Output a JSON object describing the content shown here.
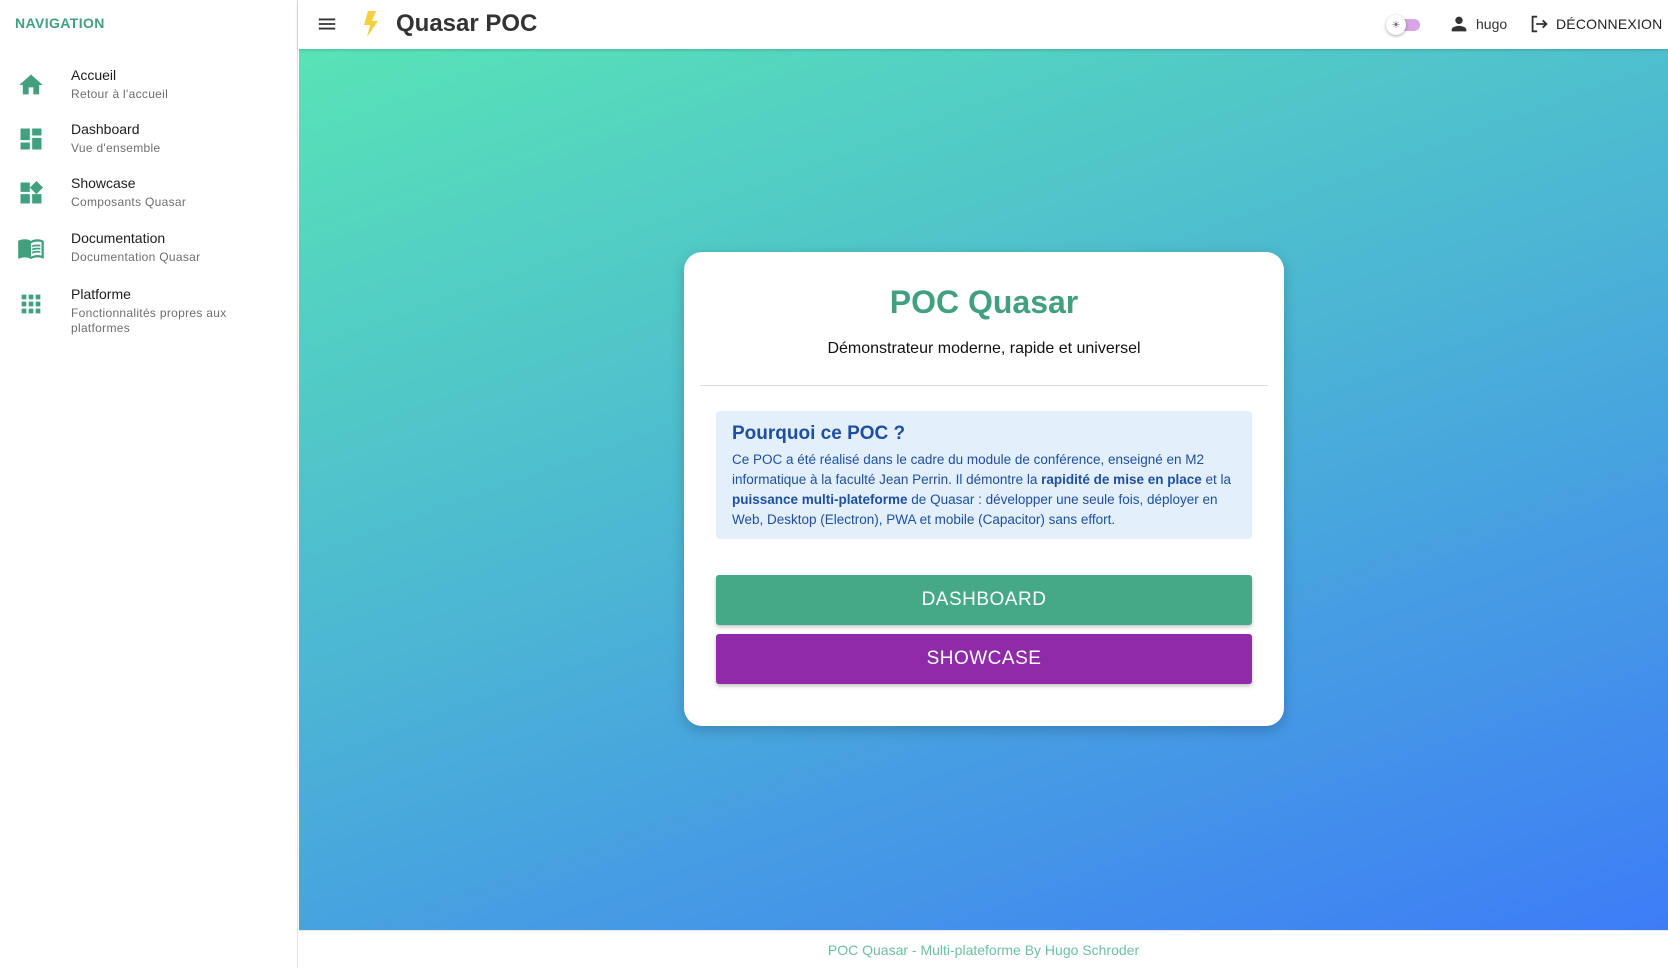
{
  "sidebar": {
    "heading": "NAVIGATION",
    "items": [
      {
        "label": "Accueil",
        "caption": "Retour à l'accueil",
        "icon": "home-icon"
      },
      {
        "label": "Dashboard",
        "caption": "Vue d'ensemble",
        "icon": "dashboard-icon"
      },
      {
        "label": "Showcase",
        "caption": "Composants Quasar",
        "icon": "widgets-icon"
      },
      {
        "label": "Documentation",
        "caption": "Documentation Quasar",
        "icon": "book-icon"
      },
      {
        "label": "Platforme",
        "caption": "Fonctionnalités propres aux platformes",
        "icon": "apps-grid-icon"
      }
    ]
  },
  "header": {
    "title": "Quasar POC",
    "username": "hugo",
    "logout_label": "DÉCONNEXION",
    "theme_toggle_on": true
  },
  "card": {
    "title": "POC Quasar",
    "subtitle": "Démonstrateur moderne, rapide et universel",
    "info_title": "Pourquoi ce POC ?",
    "info_text_1": "Ce POC a été réalisé dans le cadre du module de conférence, enseigné en M2 informatique à la faculté Jean Perrin. Il démontre la ",
    "info_bold_1": "rapidité de mise en place",
    "info_text_2": " et la ",
    "info_bold_2": "puissance multi-plateforme",
    "info_text_3": " de Quasar : développer une seule fois, déployer en Web, Desktop (Electron), PWA et mobile (Capacitor) sans effort.",
    "btn_dashboard": "DASHBOARD",
    "btn_showcase": "SHOWCASE"
  },
  "footer": {
    "text": "POC Quasar - Multi-plateforme By Hugo Schroder"
  },
  "colors": {
    "primary": "#41a07e",
    "secondary": "#8f2aa9",
    "info_text": "#1e4fa0",
    "accent_bolt": "#f4d03f"
  }
}
